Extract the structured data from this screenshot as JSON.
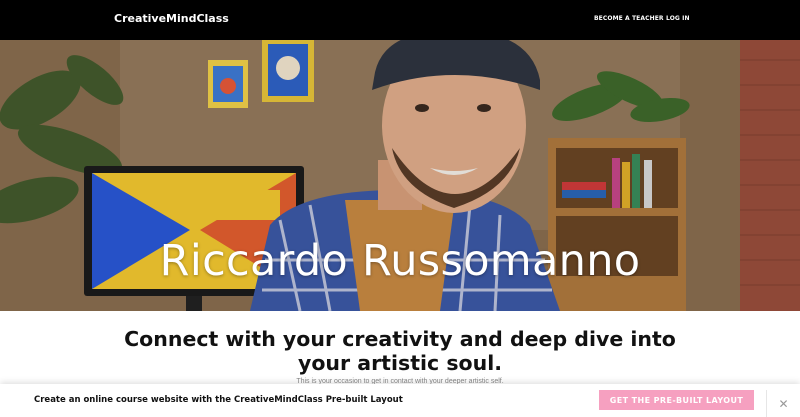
{
  "header": {
    "brand": "CreativeMindClass",
    "nav": [
      "BECOME A TEACHER",
      "LOG IN"
    ]
  },
  "hero": {
    "title": "Riccardo Russomanno",
    "image_description_icon": "presenter-photo"
  },
  "main": {
    "headline": "Connect with your creativity and deep dive into your artistic soul.",
    "subtext": "This is your occasion to get in contact with your deeper artistic self."
  },
  "promo": {
    "text": "Create an online course website with the CreativeMindClass Pre-built Layout",
    "button_label": "GET THE PRE-BUILT LAYOUT",
    "close_icon": "close-icon"
  },
  "colors": {
    "header_bg": "#000000",
    "button_bg": "#f6a0c0",
    "text_dark": "#111111"
  }
}
